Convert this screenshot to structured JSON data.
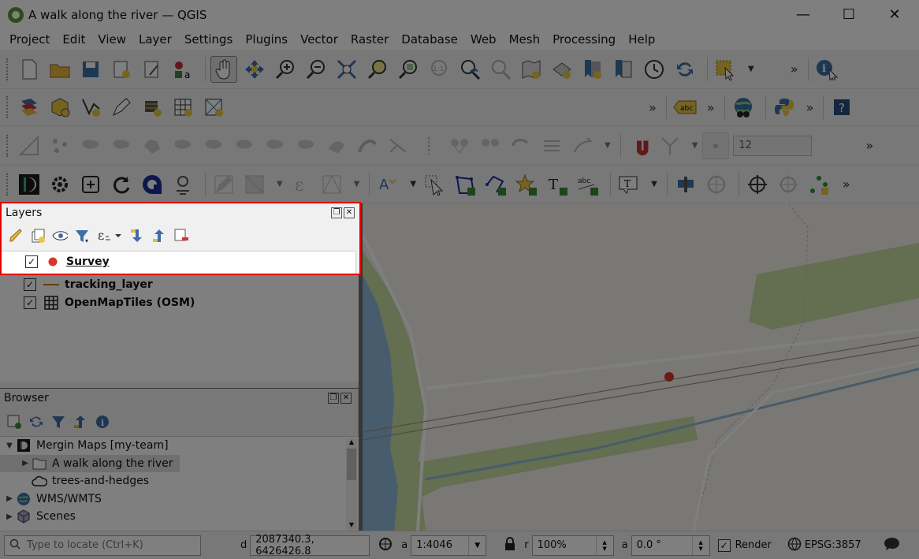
{
  "window": {
    "title": "A walk along the river — QGIS",
    "minimize": "—",
    "maximize": "☐",
    "close": "✕"
  },
  "menu": [
    "Project",
    "Edit",
    "View",
    "Layer",
    "Settings",
    "Plugins",
    "Vector",
    "Raster",
    "Database",
    "Web",
    "Mesh",
    "Processing",
    "Help"
  ],
  "toolbar": {
    "more": "»",
    "snapping_tolerance": "12"
  },
  "layers_panel": {
    "title": "Layers",
    "layers": [
      {
        "name": "Survey",
        "checked": "✓",
        "symbol": "point-red"
      },
      {
        "name": "tracking_layer",
        "checked": "✓",
        "symbol": "line-orange"
      },
      {
        "name": "OpenMapTiles (OSM)",
        "checked": "✓",
        "symbol": "grid"
      }
    ]
  },
  "browser_panel": {
    "title": "Browser",
    "items": [
      {
        "label": "Mergin Maps [my-team]",
        "arrow": "▼"
      },
      {
        "label": "A walk along the river",
        "arrow": "▶"
      },
      {
        "label": "trees-and-hedges",
        "arrow": ""
      },
      {
        "label": "WMS/WMTS",
        "arrow": "▶"
      },
      {
        "label": "Scenes",
        "arrow": "▶"
      }
    ]
  },
  "statusbar": {
    "locate_placeholder": "Type to locate (Ctrl+K)",
    "coord_label": "d",
    "coordinate": "2087340.3, 6426426.8",
    "scale_label": "a",
    "scale": "1:4046",
    "rotation_label": "r",
    "magnifier": "100%",
    "angle_label": "a",
    "rotation": "0.0 °",
    "render_label": "Render",
    "render_checked": "✓",
    "crs": "EPSG:3857"
  },
  "colors": {
    "highlight": "#e00000",
    "survey_point": "#d9352b",
    "track_line": "#c8781e",
    "river": "#8fb8d8",
    "green": "#c8dca0"
  }
}
